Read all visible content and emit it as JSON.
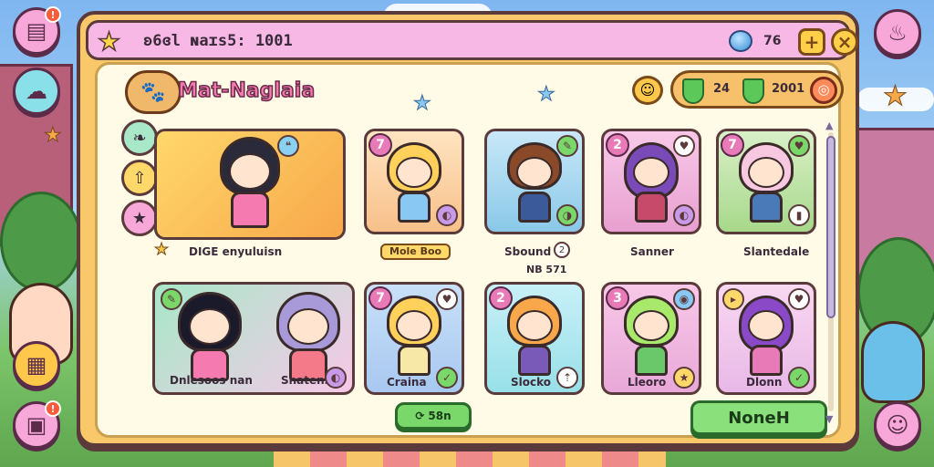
{
  "window": {
    "title": "ʚ6ɞl ɴaɪs5: 1001",
    "gem_count": "76",
    "plus_label": "+",
    "close_label": "×"
  },
  "header": {
    "logo_text": "Mat-Naglaia",
    "resource_a": "24",
    "resource_b": "2001"
  },
  "cards": [
    {
      "num": "",
      "label": "DIGE enyuluisn",
      "chip": ""
    },
    {
      "num": "7",
      "label": "",
      "chip": "Mole Boo"
    },
    {
      "num": "",
      "label": "Sbound",
      "chip": ""
    },
    {
      "num": "2",
      "label": "Sanner",
      "chip": ""
    },
    {
      "num": "7",
      "label": "Slantedale",
      "chip": ""
    },
    {
      "num": "",
      "label": "Dnlesoos nan",
      "label2": "Shatens"
    },
    {
      "num": "7",
      "label": "Craina",
      "chip": ""
    },
    {
      "num": "2",
      "label": "Slocko",
      "chip": ""
    },
    {
      "num": "3",
      "label": "Lleoro",
      "chip": ""
    },
    {
      "num": "",
      "label": "Dlonn",
      "chip": ""
    }
  ],
  "card2_badge_num": "2",
  "card3_subtext": "NB 571",
  "small_button_label": "58n",
  "main_button_label": "NoneH",
  "notifications": {
    "top_left": "!",
    "bottom_left": "!"
  },
  "icons": {
    "top_left": "journal-icon",
    "left_2": "cloud-icon",
    "bottom_left_1": "map-icon",
    "bottom_left_2": "tv-icon",
    "top_right": "cake-icon",
    "bottom_right": "character-icon"
  }
}
